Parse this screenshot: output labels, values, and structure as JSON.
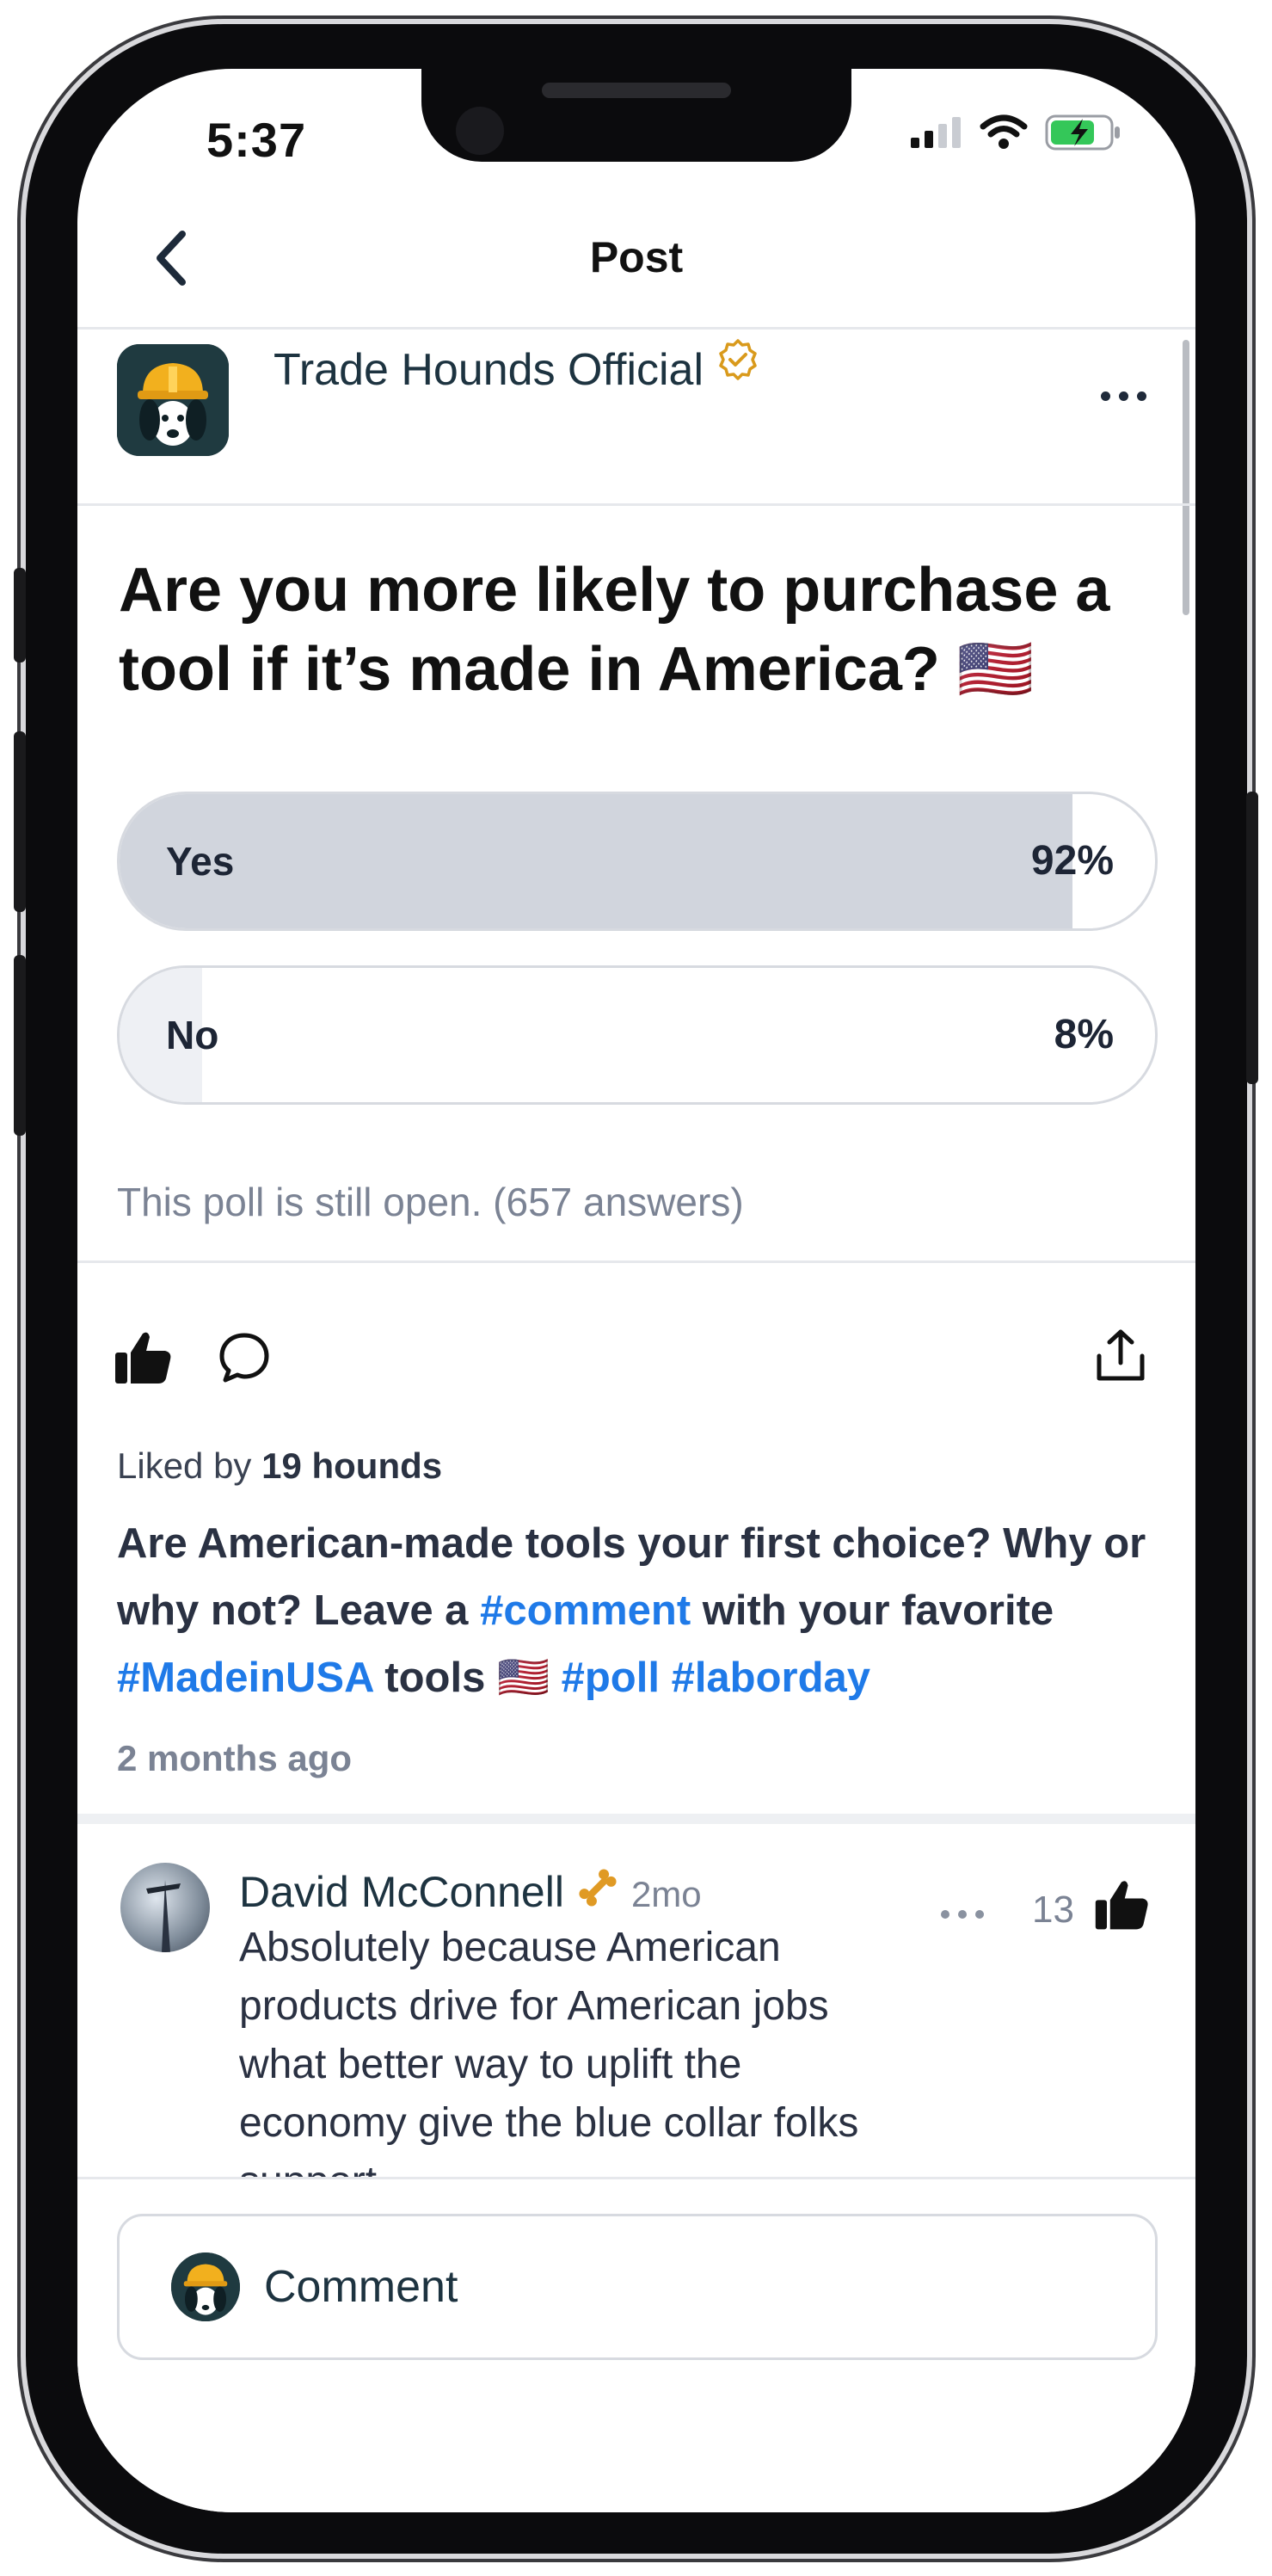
{
  "status_bar": {
    "time": "5:37"
  },
  "header": {
    "title": "Post"
  },
  "post": {
    "author": "Trade Hounds Official",
    "question": "Are you more likely to purchase a tool if it’s made in America? 🇺🇸",
    "poll": {
      "options": [
        {
          "label": "Yes",
          "percent_label": "92%",
          "percent": 92
        },
        {
          "label": "No",
          "percent_label": "8%",
          "percent": 8
        }
      ],
      "status": "This poll is still open. (657 answers)"
    },
    "liked_prefix": "Liked by",
    "liked_count": "19 hounds",
    "caption": {
      "part1": "Are American-made tools your first choice? Why or why not? Leave a ",
      "tag_comment": "#comment",
      "part2": " with your favorite ",
      "tag_madeinusa": "#MadeinUSA",
      "part3": " tools 🇺🇸 ",
      "tag_poll": "#poll",
      "tag_laborday": "#laborday"
    },
    "time_ago": "2 months ago"
  },
  "comment": {
    "author": "David McConnell",
    "age": "2mo",
    "likes": "13",
    "text": "Absolutely because American products drive for American jobs what better way to uplift the economy give the blue collar folks support"
  },
  "comment_input": {
    "placeholder": "Comment"
  },
  "colors": {
    "accent_link": "#1f7ae8",
    "verified_badge": "#d99a1c",
    "bone_badge": "#e09a24",
    "poll_fill": "#d1d5dd"
  },
  "icons": [
    "back-chevron-icon",
    "verified-badge-icon",
    "more-icon",
    "thumbs-up-icon",
    "comment-bubble-icon",
    "share-icon",
    "bone-badge-icon",
    "signal-icon",
    "wifi-icon",
    "battery-icon"
  ]
}
